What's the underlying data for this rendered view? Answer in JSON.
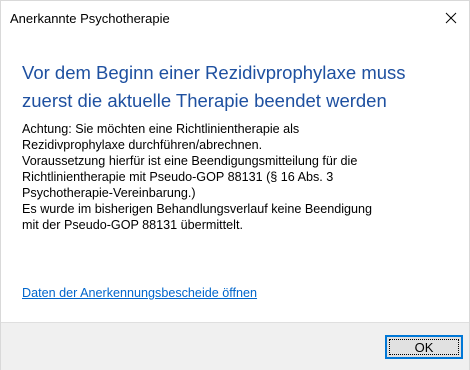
{
  "window": {
    "title": "Anerkannte Psychotherapie",
    "close_icon": "close-icon"
  },
  "dialog": {
    "heading": "Vor dem Beginn einer Rezidivprophylaxe muss zuerst die aktuelle Therapie beendet werden",
    "message_lines": [
      "Achtung: Sie möchten eine Richtlinientherapie als",
      "Rezidivprophylaxe durchführen/abrechnen.",
      "Voraussetzung hierfür ist eine Beendigungsmitteilung für die",
      "Richtlinientherapie mit Pseudo-GOP 88131 (§ 16 Abs. 3",
      "Psychotherapie-Vereinbarung.)",
      "Es wurde im bisherigen Behandlungsverlauf keine Beendigung",
      "mit der Pseudo-GOP 88131 übermittelt."
    ],
    "link_label": "Daten der Anerkennungsbescheide öffnen"
  },
  "footer": {
    "ok_label": "OK"
  },
  "colors": {
    "heading": "#1e50a0",
    "link": "#0066cc",
    "footer_bg": "#f0f0f0",
    "button_focus_border": "#0078d7"
  }
}
